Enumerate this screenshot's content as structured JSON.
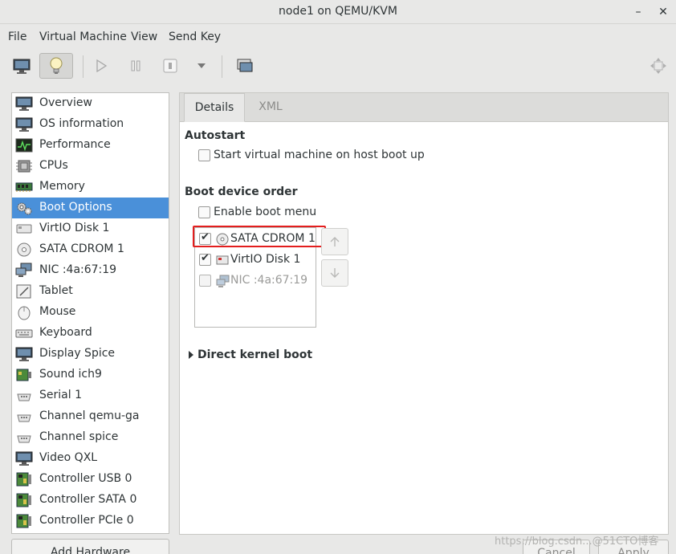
{
  "window": {
    "title": "node1 on QEMU/KVM"
  },
  "menubar": {
    "items": [
      "File",
      "Virtual Machine",
      "View",
      "Send Key"
    ]
  },
  "sidebar": {
    "items": [
      {
        "label": "Overview",
        "icon": "monitor-icon"
      },
      {
        "label": "OS information",
        "icon": "monitor-info-icon"
      },
      {
        "label": "Performance",
        "icon": "performance-graph-icon"
      },
      {
        "label": "CPUs",
        "icon": "cpu-chip-icon"
      },
      {
        "label": "Memory",
        "icon": "memory-module-icon"
      },
      {
        "label": "Boot Options",
        "icon": "boot-gear-icon"
      },
      {
        "label": "VirtIO Disk 1",
        "icon": "hard-disk-icon"
      },
      {
        "label": "SATA CDROM 1",
        "icon": "cdrom-icon"
      },
      {
        "label": "NIC :4a:67:19",
        "icon": "network-icon"
      },
      {
        "label": "Tablet",
        "icon": "tablet-icon"
      },
      {
        "label": "Mouse",
        "icon": "mouse-icon"
      },
      {
        "label": "Keyboard",
        "icon": "keyboard-icon"
      },
      {
        "label": "Display Spice",
        "icon": "display-icon"
      },
      {
        "label": "Sound ich9",
        "icon": "sound-card-icon"
      },
      {
        "label": "Serial 1",
        "icon": "serial-port-icon"
      },
      {
        "label": "Channel qemu-ga",
        "icon": "channel-icon"
      },
      {
        "label": "Channel spice",
        "icon": "channel-icon"
      },
      {
        "label": "Video QXL",
        "icon": "video-icon"
      },
      {
        "label": "Controller USB 0",
        "icon": "controller-card-icon"
      },
      {
        "label": "Controller SATA 0",
        "icon": "controller-card-icon"
      },
      {
        "label": "Controller PCIe 0",
        "icon": "controller-card-icon"
      }
    ],
    "selected": "Boot Options",
    "add_hardware_label": "Add Hardware"
  },
  "tabs": {
    "details": "Details",
    "xml": "XML"
  },
  "autostart": {
    "heading": "Autostart",
    "checkbox_label": "Start virtual machine on host boot up",
    "checked": false
  },
  "boot": {
    "heading": "Boot device order",
    "enable_menu_label": "Enable boot menu",
    "enable_menu_checked": false,
    "devices": [
      {
        "label": "SATA CDROM 1",
        "checked": true,
        "enabled": true
      },
      {
        "label": "VirtIO Disk 1",
        "checked": true,
        "enabled": true
      },
      {
        "label": "NIC :4a:67:19",
        "checked": false,
        "enabled": false
      }
    ]
  },
  "direct_kernel": {
    "label": "Direct kernel boot"
  },
  "buttons": {
    "cancel": "Cancel",
    "apply": "Apply"
  },
  "watermark": "https://blog.csdn...@51CTO博客",
  "colors": {
    "selection": "#4a90d9",
    "highlight_box": "#e31e1e",
    "background": "#e8e8e7"
  }
}
